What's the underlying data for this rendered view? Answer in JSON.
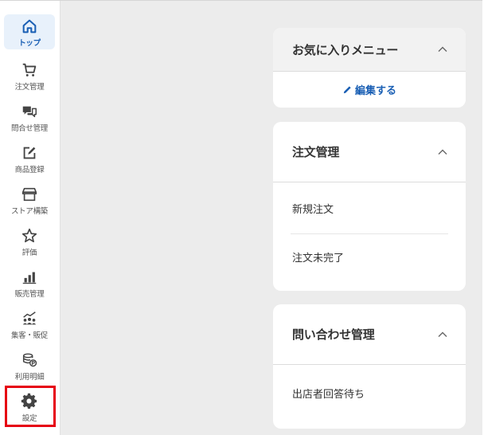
{
  "sidebar": {
    "items": [
      {
        "label": "トップ",
        "icon": "home-icon",
        "active": true
      },
      {
        "label": "注文管理",
        "icon": "cart-icon"
      },
      {
        "label": "問合せ管理",
        "icon": "chat-icon"
      },
      {
        "label": "商品登録",
        "icon": "edit-icon"
      },
      {
        "label": "ストア構築",
        "icon": "store-icon"
      },
      {
        "label": "評価",
        "icon": "star-icon"
      },
      {
        "label": "販売管理",
        "icon": "bar-chart-icon"
      },
      {
        "label": "集客・販促",
        "icon": "people-chart-icon"
      },
      {
        "label": "利用明細",
        "icon": "coins-icon"
      },
      {
        "label": "設定",
        "icon": "gear-icon",
        "highlighted": true
      }
    ]
  },
  "favorites": {
    "title": "お気に入りメニュー",
    "edit_label": "編集する"
  },
  "orders": {
    "title": "注文管理",
    "items": [
      "新規注文",
      "注文未完了"
    ]
  },
  "inquiries": {
    "title": "問い合わせ管理",
    "items": [
      "出店者回答待ち"
    ]
  },
  "colors": {
    "accent": "#1a5fb4",
    "highlight": "#e60012",
    "background": "#ececec"
  }
}
